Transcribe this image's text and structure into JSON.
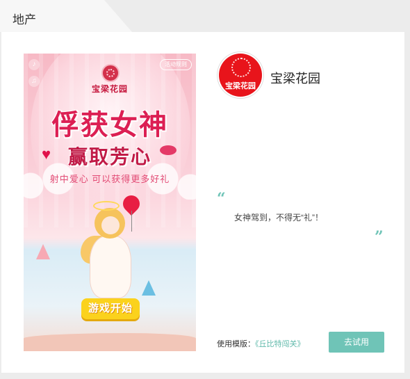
{
  "tab": {
    "label": "地产"
  },
  "preview": {
    "brand": "宝梁花园",
    "headline": "俘获女神",
    "subhead": "赢取芳心",
    "tagline": "射中爱心 可以获得更多好礼",
    "rules_label": "活动规则",
    "start_button": "游戏开始"
  },
  "company": {
    "name": "宝梁花园",
    "logo_text": "宝梁花园"
  },
  "quote": {
    "open": "“",
    "text": "女神驾到，不得无“礼”！",
    "close": "”"
  },
  "template": {
    "prefix": "使用模版：",
    "name": "《丘比特闯关》"
  },
  "try_button": "去试用",
  "colors": {
    "accent": "#6fc4b7",
    "brand_red": "#e8141b",
    "headline_pink": "#dc1f53"
  }
}
